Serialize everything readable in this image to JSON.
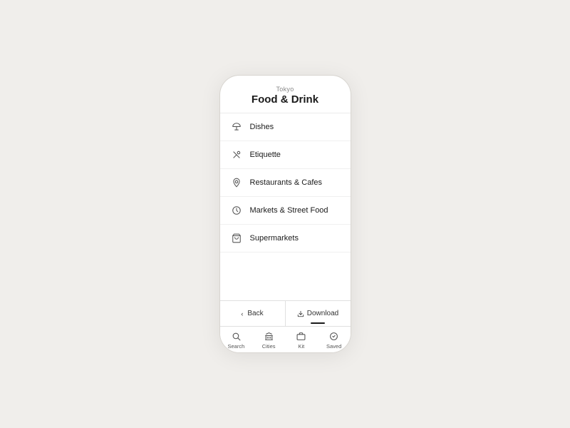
{
  "header": {
    "city": "Tokyo",
    "title": "Food & Drink"
  },
  "menu": {
    "items": [
      {
        "id": "dishes",
        "label": "Dishes",
        "icon": "dishes"
      },
      {
        "id": "etiquette",
        "label": "Etiquette",
        "icon": "etiquette"
      },
      {
        "id": "restaurants",
        "label": "Restaurants & Cafes",
        "icon": "restaurants"
      },
      {
        "id": "markets",
        "label": "Markets & Street Food",
        "icon": "markets"
      },
      {
        "id": "supermarkets",
        "label": "Supermarkets",
        "icon": "supermarkets"
      }
    ]
  },
  "actions": {
    "back": "Back",
    "download": "Download"
  },
  "tabs": [
    {
      "id": "search",
      "label": "Search"
    },
    {
      "id": "cities",
      "label": "Cities"
    },
    {
      "id": "kit",
      "label": "Kit"
    },
    {
      "id": "saved",
      "label": "Saved"
    }
  ],
  "colors": {
    "background": "#f0eeeb",
    "phone_bg": "#ffffff",
    "border": "#d8d5d0",
    "text_primary": "#1a1a1a",
    "text_secondary": "#888888",
    "icon_color": "#555555"
  }
}
